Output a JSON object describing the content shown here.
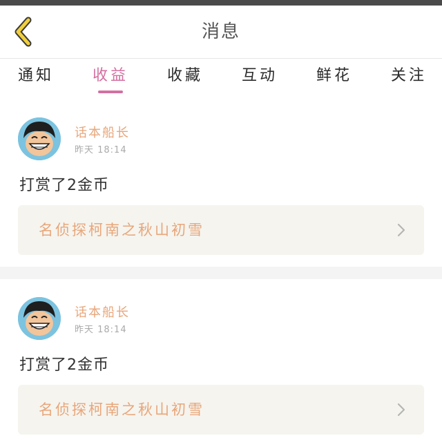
{
  "header": {
    "title": "消息",
    "back_icon": "chevron-left-icon",
    "accent_back": "#f0cf3c"
  },
  "tabs": [
    {
      "label": "通知",
      "active": false
    },
    {
      "label": "收益",
      "active": true
    },
    {
      "label": "收藏",
      "active": false
    },
    {
      "label": "互动",
      "active": false
    },
    {
      "label": "鲜花",
      "active": false
    },
    {
      "label": "关注",
      "active": false
    }
  ],
  "colors": {
    "active_tab": "#d46fa0",
    "username": "#e8a679",
    "ref_box_bg": "#f5f4ef"
  },
  "messages": [
    {
      "user": "话本船长",
      "time": "昨天 18:14",
      "text": "打赏了2金币",
      "ref_title": "名侦探柯南之秋山初雪",
      "avatar_icon": "avatar-cartoon-boy"
    },
    {
      "user": "话本船长",
      "time": "昨天 18:14",
      "text": "打赏了2金币",
      "ref_title": "名侦探柯南之秋山初雪",
      "avatar_icon": "avatar-cartoon-boy"
    }
  ]
}
